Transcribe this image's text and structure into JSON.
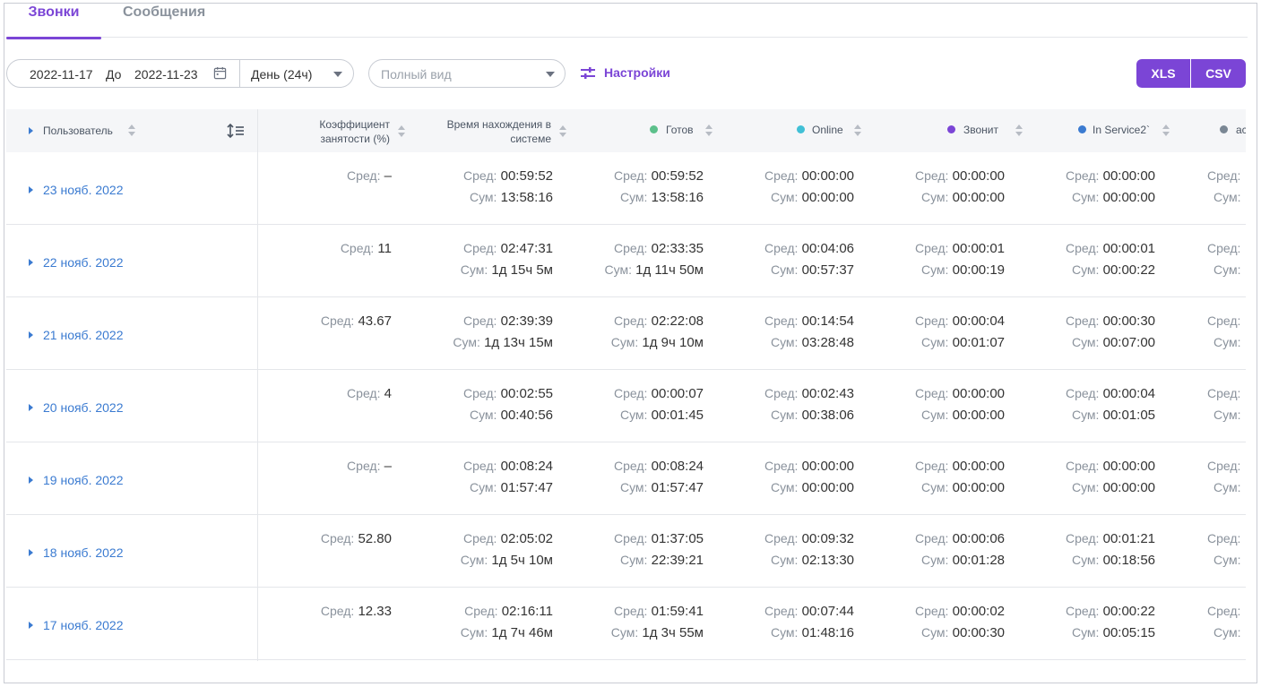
{
  "tabs": [
    {
      "label": "Звонки",
      "active": true
    },
    {
      "label": "Сообщения",
      "active": false
    }
  ],
  "toolbar": {
    "date_from": "2022-11-17",
    "to_label": "До",
    "date_to": "2022-11-23",
    "period": "День (24ч)",
    "view_placeholder": "Полный вид",
    "settings_label": "Настройки",
    "xls_label": "XLS",
    "csv_label": "CSV"
  },
  "colors": {
    "accent": "#7b45d6",
    "link": "#3b7bd1",
    "ready": "#5cc08b",
    "online": "#41c0d6",
    "calling": "#7b45d6",
    "in_service": "#3b7bd1",
    "other": "#7a8794"
  },
  "table": {
    "headers": {
      "user": "Пользователь",
      "occupancy_line1": "Коэффициент",
      "occupancy_line2": "занятости (%)",
      "time_line1": "Время нахождения в",
      "time_line2": "системе",
      "ready": "Готов",
      "online": "Online",
      "calling": "Звонит",
      "in_service": "In Service2`",
      "partial": "ac"
    },
    "labels": {
      "avg": "Сред:",
      "sum": "Сум:"
    },
    "rows": [
      {
        "date": "23 нояб. 2022",
        "occ": "–",
        "time_avg": "00:59:52",
        "time_sum": "13:58:16",
        "ready_avg": "00:59:52",
        "ready_sum": "13:58:16",
        "online_avg": "00:00:00",
        "online_sum": "00:00:00",
        "call_avg": "00:00:00",
        "call_sum": "00:00:00",
        "svc_avg": "00:00:00",
        "svc_sum": "00:00:00"
      },
      {
        "date": "22 нояб. 2022",
        "occ": "11",
        "time_avg": "02:47:31",
        "time_sum": "1д 15ч 5м",
        "ready_avg": "02:33:35",
        "ready_sum": "1д 11ч 50м",
        "online_avg": "00:04:06",
        "online_sum": "00:57:37",
        "call_avg": "00:00:01",
        "call_sum": "00:00:19",
        "svc_avg": "00:00:01",
        "svc_sum": "00:00:22"
      },
      {
        "date": "21 нояб. 2022",
        "occ": "43.67",
        "time_avg": "02:39:39",
        "time_sum": "1д 13ч 15м",
        "ready_avg": "02:22:08",
        "ready_sum": "1д 9ч 10м",
        "online_avg": "00:14:54",
        "online_sum": "03:28:48",
        "call_avg": "00:00:04",
        "call_sum": "00:01:07",
        "svc_avg": "00:00:30",
        "svc_sum": "00:07:00"
      },
      {
        "date": "20 нояб. 2022",
        "occ": "4",
        "time_avg": "00:02:55",
        "time_sum": "00:40:56",
        "ready_avg": "00:00:07",
        "ready_sum": "00:01:45",
        "online_avg": "00:02:43",
        "online_sum": "00:38:06",
        "call_avg": "00:00:00",
        "call_sum": "00:00:00",
        "svc_avg": "00:00:04",
        "svc_sum": "00:01:05"
      },
      {
        "date": "19 нояб. 2022",
        "occ": "–",
        "time_avg": "00:08:24",
        "time_sum": "01:57:47",
        "ready_avg": "00:08:24",
        "ready_sum": "01:57:47",
        "online_avg": "00:00:00",
        "online_sum": "00:00:00",
        "call_avg": "00:00:00",
        "call_sum": "00:00:00",
        "svc_avg": "00:00:00",
        "svc_sum": "00:00:00"
      },
      {
        "date": "18 нояб. 2022",
        "occ": "52.80",
        "time_avg": "02:05:02",
        "time_sum": "1д 5ч 10м",
        "ready_avg": "01:37:05",
        "ready_sum": "22:39:21",
        "online_avg": "00:09:32",
        "online_sum": "02:13:30",
        "call_avg": "00:00:06",
        "call_sum": "00:01:28",
        "svc_avg": "00:01:21",
        "svc_sum": "00:18:56"
      },
      {
        "date": "17 нояб. 2022",
        "occ": "12.33",
        "time_avg": "02:16:11",
        "time_sum": "1д 7ч 46м",
        "ready_avg": "01:59:41",
        "ready_sum": "1д 3ч 55м",
        "online_avg": "00:07:44",
        "online_sum": "01:48:16",
        "call_avg": "00:00:02",
        "call_sum": "00:00:30",
        "svc_avg": "00:00:22",
        "svc_sum": "00:05:15"
      }
    ]
  }
}
